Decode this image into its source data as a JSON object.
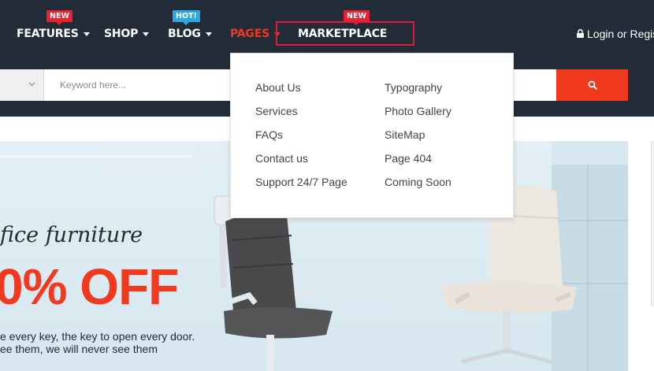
{
  "nav": {
    "items": [
      {
        "label": "FEATURES",
        "badge": "NEW"
      },
      {
        "label": "SHOP"
      },
      {
        "label": "BLOG",
        "badge": "HOT!"
      },
      {
        "label": "PAGES",
        "active": true
      },
      {
        "label": "MARKETPLACE",
        "badge": "NEW"
      }
    ],
    "login_label": "Login or Regis"
  },
  "search": {
    "placeholder": "Keyword here..."
  },
  "dropdown": {
    "column_1": [
      "About Us",
      "Services",
      "FAQs",
      "Contact us",
      "Support 24/7 Page"
    ],
    "column_2": [
      "Typography",
      "Photo Gallery",
      "SiteMap",
      "Page 404",
      "Coming Soon"
    ]
  },
  "hero": {
    "script_title": "fice furniture",
    "discount": "0% OFF",
    "line_1": "e every key, the key to open every door.",
    "line_2": "ee them, we will never see them"
  },
  "colors": {
    "header_bg": "#222b38",
    "accent": "#f0391f",
    "badge_new": "#e8202f",
    "badge_hot": "#2ba9df",
    "highlight_border": "#e01b3c"
  }
}
